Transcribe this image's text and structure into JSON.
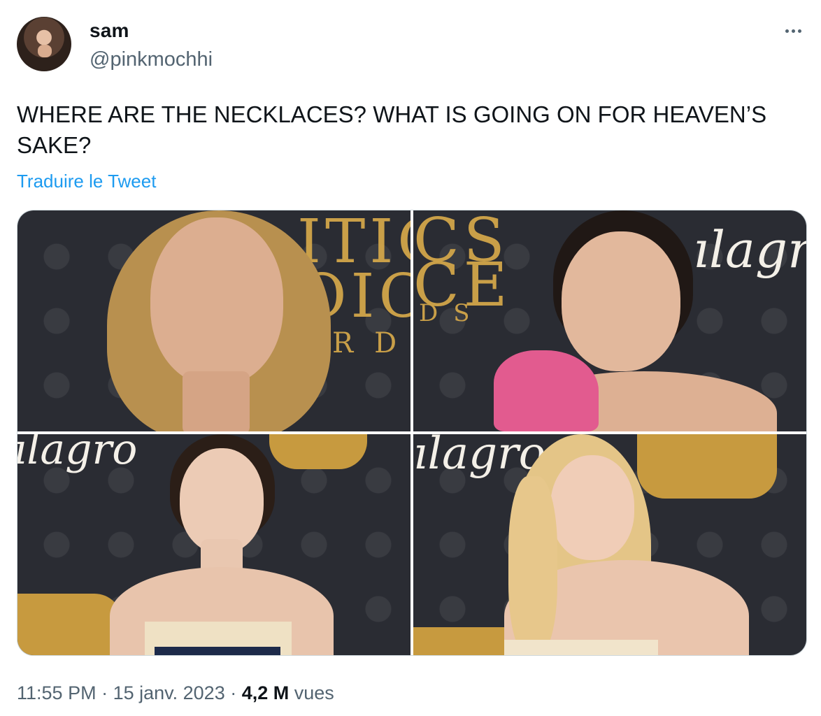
{
  "author": {
    "name": "sam",
    "handle": "@pinkmochhi",
    "avatar_icon": "profile-avatar"
  },
  "more_icon": "more-options-icon",
  "tweet": {
    "text": "WHERE ARE THE NECKLACES? WHAT IS GOING ON FOR HEAVEN’S SAKE?",
    "translate_label": "Traduire le Tweet"
  },
  "media": {
    "photos": [
      {
        "id": "photo-1"
      },
      {
        "id": "photo-2"
      },
      {
        "id": "photo-3"
      },
      {
        "id": "photo-4"
      }
    ]
  },
  "footer": {
    "time": "11:55 PM",
    "sep1": " · ",
    "date": "15 janv. 2023",
    "sep2": " · ",
    "views": "4,2 M",
    "views_label": " vues"
  },
  "colors": {
    "link": "#1d9bf0",
    "secondary_text": "#536471",
    "backdrop": "#2a2c33",
    "gold": "#c79a3f"
  }
}
